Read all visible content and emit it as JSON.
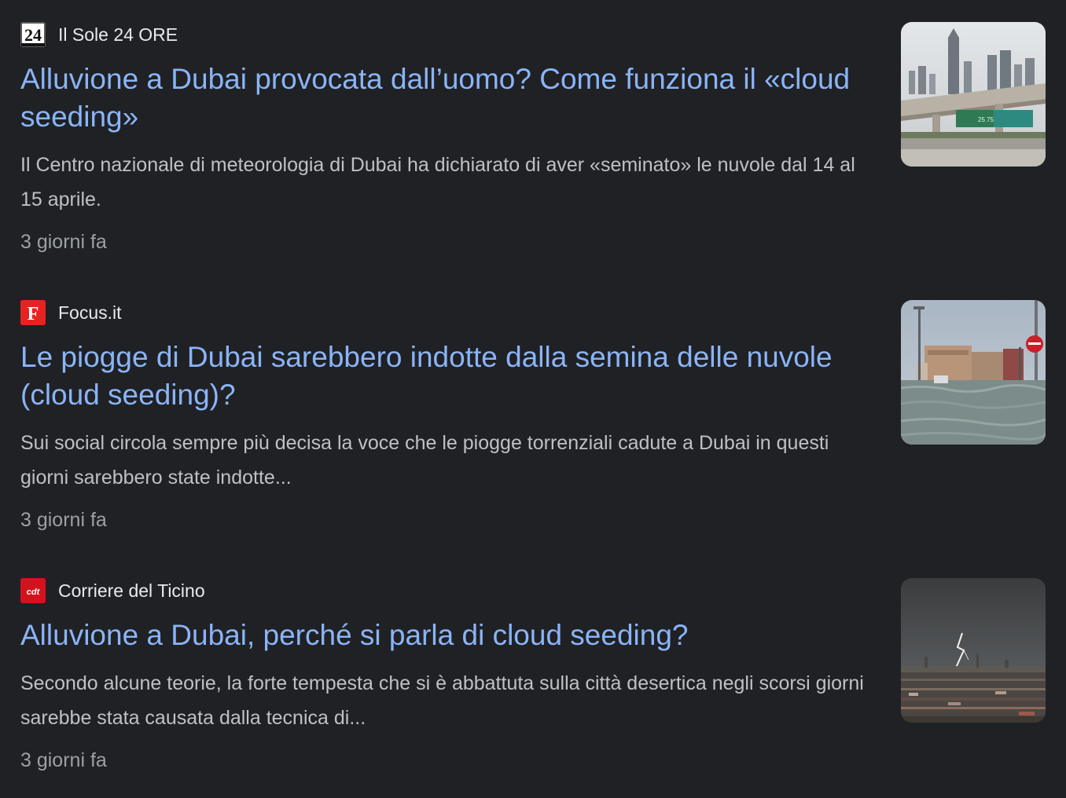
{
  "articles": [
    {
      "source": "Il Sole 24 ORE",
      "favicon_icon": "sole24ore-logo-icon",
      "favicon_text": "24",
      "headline": "Alluvione a Dubai provocata dall’uomo? Come funziona il «cloud seeding»",
      "snippet": "Il Centro nazionale di meteorologia di Dubai ha dichiarato di aver «seminato» le nuvole dal 14 al 15 aprile.",
      "time": "3 giorni fa",
      "thumbnail": "dubai-highway-skyline-image"
    },
    {
      "source": "Focus.it",
      "favicon_icon": "focus-logo-icon",
      "favicon_text": "F",
      "headline": "Le piogge di Dubai sarebbero indotte dalla semina delle nuvole (cloud seeding)?",
      "snippet": "Sui social circola sempre più decisa la voce che le piogge torrenziali cadute a Dubai in questi giorni sarebbero state indotte...",
      "time": "3 giorni fa",
      "thumbnail": "flooded-street-image"
    },
    {
      "source": "Corriere del Ticino",
      "favicon_icon": "cdt-logo-icon",
      "favicon_text": "cdt",
      "headline": "Alluvione a Dubai, perché si parla di cloud seeding?",
      "snippet": "Secondo alcune teorie, la forte tempesta che si è abbattuta sulla città desertica negli scorsi giorni sarebbe stata causata dalla tecnica di...",
      "time": "3 giorni fa",
      "thumbnail": "storm-lightning-city-image"
    }
  ],
  "colors": {
    "background": "#202124",
    "headline": "#8ab4f8",
    "snippet": "#bdc1c6",
    "source": "#e8eaed",
    "time": "#9aa0a6",
    "focus_red": "#e52421",
    "cdt_red": "#d4121e"
  }
}
